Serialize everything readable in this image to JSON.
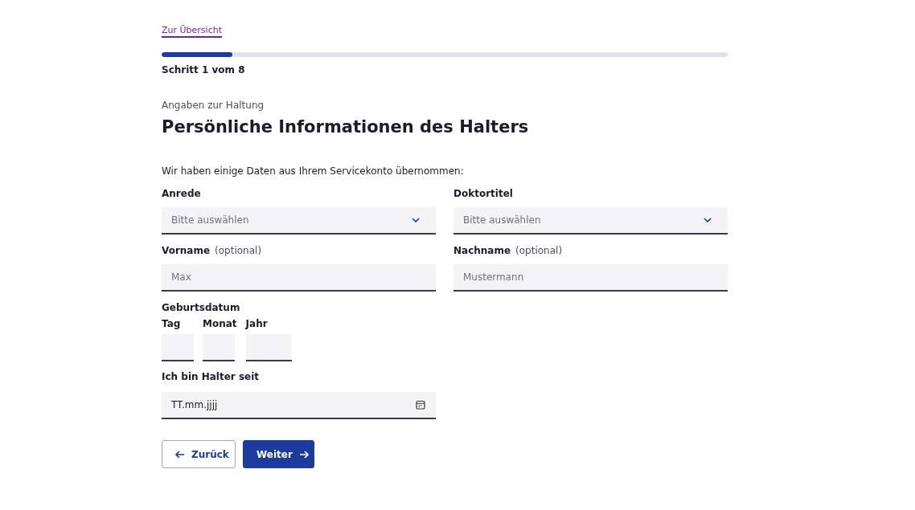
{
  "back_link": "Zur Übersicht",
  "progress": {
    "level": 0.125,
    "label": "Schritt 1 vom 8"
  },
  "section": "Angaben zur Haltung",
  "heading": "Persönliche Informationen des Halters",
  "intro": "Wir haben einige Daten aus Ihrem Servicekonto übernommen:",
  "field_rows": [
    [
      {
        "kind": "select",
        "label": "Anrede",
        "placeholder": "Bitte auswählen"
      },
      {
        "kind": "select",
        "label": "Doktortitel",
        "placeholder": "Bitte auswählen"
      }
    ],
    [
      {
        "kind": "text",
        "label": "Vorname",
        "hint": "(optional)",
        "placeholder": "Max"
      },
      {
        "kind": "text",
        "label": "Nachname",
        "hint": "(optional)",
        "placeholder": "Mustermann"
      }
    ]
  ],
  "birthdate": {
    "label": "Geburtsdatum",
    "parts": [
      {
        "label": "Tag"
      },
      {
        "label": "Monat"
      },
      {
        "label": "Jahr"
      }
    ]
  },
  "holder_since": {
    "label": "Ich bin Halter seit",
    "value": "TT.mm.jjjj"
  },
  "buttons": [
    {
      "kind": "secondary",
      "label": "Zurück"
    },
    {
      "kind": "primary",
      "label": "Weiter"
    }
  ]
}
